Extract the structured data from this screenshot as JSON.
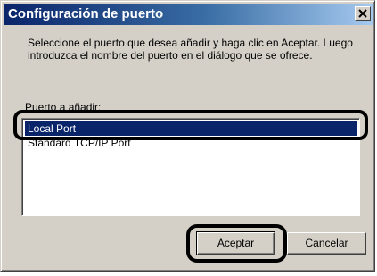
{
  "window": {
    "title": "Configuración de puerto",
    "close_icon": "close-icon"
  },
  "instructions": "Seleccione el puerto que desea añadir y haga clic en Aceptar. Luego introduzca el nombre del puerto en el diálogo que se ofrece.",
  "port_field": {
    "label": "Puerto a añadir:",
    "items": [
      {
        "label": "Local Port",
        "selected": true
      },
      {
        "label": "Standard TCP/IP Port",
        "selected": false
      }
    ]
  },
  "buttons": {
    "ok_label": "Aceptar",
    "cancel_label": "Cancelar"
  },
  "colors": {
    "title_bar_start": "#0a246a",
    "title_bar_end": "#a6caf0",
    "selection": "#0a246a",
    "dialog_face": "#d4d0c8"
  }
}
